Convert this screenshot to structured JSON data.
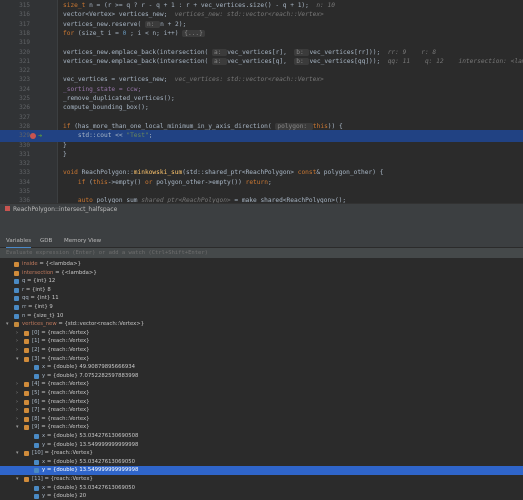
{
  "editor": {
    "lines": [
      {
        "n": "315",
        "segs": [
          [
            "kw",
            "size_t "
          ],
          [
            "",
            "n = (r >= q ? r - q + 1 : r + vec_vertices.size() - q + 1);  "
          ],
          [
            "hint",
            "n: 10"
          ]
        ]
      },
      {
        "n": "316",
        "segs": [
          [
            "",
            "vector<Vertex> vertices_new;  "
          ],
          [
            "hint",
            "vertices_new: std::vector<reach::Vertex>"
          ]
        ]
      },
      {
        "n": "317",
        "segs": [
          [
            "",
            "vertices_new.reserve( "
          ],
          [
            "pill",
            "n: "
          ],
          [
            "",
            "n + 2);"
          ]
        ]
      },
      {
        "n": "318",
        "segs": [
          [
            "kw",
            "for "
          ],
          [
            "",
            "(size_t i = "
          ],
          [
            "num",
            "0"
          ],
          [
            "",
            " ; i < n; i++) "
          ],
          [
            "pill",
            "{...}"
          ]
        ]
      },
      {
        "n": "319",
        "segs": []
      },
      {
        "n": "320",
        "segs": [
          [
            "",
            "vertices_new.emplace_back(intersection( "
          ],
          [
            "pill",
            "a: "
          ],
          [
            "",
            "vec_vertices[r],  "
          ],
          [
            "pill",
            "b: "
          ],
          [
            "",
            "vec_vertices[rr]));  "
          ],
          [
            "hint",
            "rr: 9    r: 8"
          ]
        ]
      },
      {
        "n": "321",
        "segs": [
          [
            "",
            "vertices_new.emplace_back(intersection( "
          ],
          [
            "pill",
            "a: "
          ],
          [
            "",
            "vec_vertices[q],  "
          ],
          [
            "pill",
            "b: "
          ],
          [
            "",
            "vec_vertices[qq]));  "
          ],
          [
            "hint",
            "qq: 11    q: 12    intersection: <lambda>"
          ]
        ]
      },
      {
        "n": "322",
        "segs": []
      },
      {
        "n": "323",
        "segs": [
          [
            "",
            "vec_vertices = vertices_new;  "
          ],
          [
            "hint",
            "vec_vertices: std::vector<reach::Vertex>"
          ]
        ]
      },
      {
        "n": "324",
        "segs": [
          [
            "purple",
            "_sorting_state = ccw;"
          ]
        ]
      },
      {
        "n": "325",
        "segs": [
          [
            "",
            "_remove_duplicated_vertices();"
          ]
        ]
      },
      {
        "n": "326",
        "segs": [
          [
            "",
            "compute_bounding_box();"
          ]
        ]
      },
      {
        "n": "327",
        "segs": []
      },
      {
        "n": "328",
        "segs": [
          [
            "kw",
            "if "
          ],
          [
            "",
            "(has_more_than_one_local_minimum_in_y_axis_direction( "
          ],
          [
            "pill",
            "polygon: "
          ],
          [
            "kw",
            "this"
          ],
          [
            "",
            ")) {"
          ]
        ]
      },
      {
        "n": "329",
        "segs": [
          [
            "",
            "    std::cout << "
          ],
          [
            "str",
            "\"Test\""
          ],
          [
            ";",
            ""
          ]
        ]
      },
      {
        "n": "330",
        "segs": [
          [
            "",
            "}"
          ]
        ]
      },
      {
        "n": "331",
        "segs": [
          [
            "",
            "}"
          ]
        ]
      },
      {
        "n": "332",
        "segs": []
      },
      {
        "n": "333",
        "segs": [
          [
            "kw",
            "void "
          ],
          [
            "",
            "ReachPolygon::"
          ],
          [
            "fn",
            "minkowski_sum"
          ],
          [
            "",
            "(std::shared_ptr<ReachPolygon> "
          ],
          [
            "kw",
            "const"
          ],
          [
            "",
            "& polygon_other) {"
          ]
        ]
      },
      {
        "n": "334",
        "segs": [
          [
            "",
            "    "
          ],
          [
            "kw",
            "if "
          ],
          [
            "",
            "("
          ],
          [
            "kw",
            "this"
          ],
          [
            "",
            "->empty() "
          ],
          [
            "kw",
            "or "
          ],
          [
            "",
            "polygon_other->empty()) "
          ],
          [
            "kw",
            "return"
          ],
          [
            ";",
            ""
          ]
        ]
      },
      {
        "n": "335",
        "segs": []
      },
      {
        "n": "336",
        "segs": [
          [
            "",
            "    "
          ],
          [
            "kw",
            "auto "
          ],
          [
            "",
            "polygon_sum "
          ],
          [
            "hint",
            "shared_ptr<ReachPolygon>"
          ],
          [
            "",
            " = make_shared<ReachPolygon>();"
          ]
        ]
      }
    ]
  },
  "breadcrumb": "ReachPolygon::intersect_halfspace",
  "tabs": {
    "variables": "Variables",
    "gdb": "GDB",
    "memory": "Memory View"
  },
  "eval_placeholder": "Evaluate expression (Enter) or add a watch (Ctrl+Shift+Enter)",
  "variables": [
    {
      "d": 0,
      "t": "",
      "i": "obj",
      "name": "inside",
      "val": " = {<lambda>}",
      "style": "vname"
    },
    {
      "d": 0,
      "t": "",
      "i": "obj",
      "name": "intersection",
      "val": " = {<lambda>}",
      "style": "vname"
    },
    {
      "d": 0,
      "t": "",
      "i": "prim",
      "name": "q",
      "val": " = {int} 12",
      "style": "vname2"
    },
    {
      "d": 0,
      "t": "",
      "i": "prim",
      "name": "r",
      "val": " = {int} 8",
      "style": "vname2"
    },
    {
      "d": 0,
      "t": "",
      "i": "prim",
      "name": "qq",
      "val": " = {int} 11",
      "style": "vname2"
    },
    {
      "d": 0,
      "t": "",
      "i": "prim",
      "name": "rr",
      "val": " = {int} 9",
      "style": "vname2"
    },
    {
      "d": 0,
      "t": "",
      "i": "prim",
      "name": "n",
      "val": " = {size_t} 10",
      "style": "vname2"
    },
    {
      "d": 0,
      "t": "▾",
      "i": "arr",
      "name": "vertices_new",
      "val": " = {std::vector<reach::Vertex>}",
      "style": "vname"
    },
    {
      "d": 1,
      "t": "›",
      "i": "obj",
      "name": "[0]",
      "val": " = {reach::Vertex}",
      "style": "vname2"
    },
    {
      "d": 1,
      "t": "›",
      "i": "obj",
      "name": "[1]",
      "val": " = {reach::Vertex}",
      "style": "vname2"
    },
    {
      "d": 1,
      "t": "›",
      "i": "obj",
      "name": "[2]",
      "val": " = {reach::Vertex}",
      "style": "vname2"
    },
    {
      "d": 1,
      "t": "▾",
      "i": "obj",
      "name": "[3]",
      "val": " = {reach::Vertex}",
      "style": "vname2"
    },
    {
      "d": 2,
      "t": "",
      "i": "prim",
      "name": "x",
      "val": " = {double} 49.90879895666934",
      "style": "vname2"
    },
    {
      "d": 2,
      "t": "",
      "i": "prim",
      "name": "y",
      "val": " = {double} 7.0752282597883998",
      "style": "vname2"
    },
    {
      "d": 1,
      "t": "›",
      "i": "obj",
      "name": "[4]",
      "val": " = {reach::Vertex}",
      "style": "vname2"
    },
    {
      "d": 1,
      "t": "›",
      "i": "obj",
      "name": "[5]",
      "val": " = {reach::Vertex}",
      "style": "vname2"
    },
    {
      "d": 1,
      "t": "›",
      "i": "obj",
      "name": "[6]",
      "val": " = {reach::Vertex}",
      "style": "vname2"
    },
    {
      "d": 1,
      "t": "›",
      "i": "obj",
      "name": "[7]",
      "val": " = {reach::Vertex}",
      "style": "vname2"
    },
    {
      "d": 1,
      "t": "›",
      "i": "obj",
      "name": "[8]",
      "val": " = {reach::Vertex}",
      "style": "vname2"
    },
    {
      "d": 1,
      "t": "▾",
      "i": "obj",
      "name": "[9]",
      "val": " = {reach::Vertex}",
      "style": "vname2"
    },
    {
      "d": 2,
      "t": "",
      "i": "prim",
      "name": "x",
      "val": " = {double} 53.034276130690508",
      "style": "vname2"
    },
    {
      "d": 2,
      "t": "",
      "i": "prim",
      "name": "y",
      "val": " = {double} 13.549999999999998",
      "style": "vname2"
    },
    {
      "d": 1,
      "t": "▾",
      "i": "obj",
      "name": "[10]",
      "val": " = {reach::Vertex}",
      "style": "vname2"
    },
    {
      "d": 2,
      "t": "",
      "i": "prim",
      "name": "x",
      "val": " = {double} 53.03427613069050",
      "style": "vname2"
    },
    {
      "d": 2,
      "t": "",
      "i": "prim",
      "name": "y",
      "val": " = {double} 13.549999999999998",
      "style": "vname2",
      "sel": true
    },
    {
      "d": 1,
      "t": "▾",
      "i": "obj",
      "name": "[11]",
      "val": " = {reach::Vertex}",
      "style": "vname2"
    },
    {
      "d": 2,
      "t": "",
      "i": "prim",
      "name": "x",
      "val": " = {double} 53.03427613069050",
      "style": "vname2"
    },
    {
      "d": 2,
      "t": "",
      "i": "prim",
      "name": "y",
      "val": " = {double} 20",
      "style": "vname2"
    }
  ],
  "highlight_line": "329",
  "colors": {
    "accent": "#2f65ca",
    "breakpoint": "#c75450",
    "highlight": "#214283"
  }
}
